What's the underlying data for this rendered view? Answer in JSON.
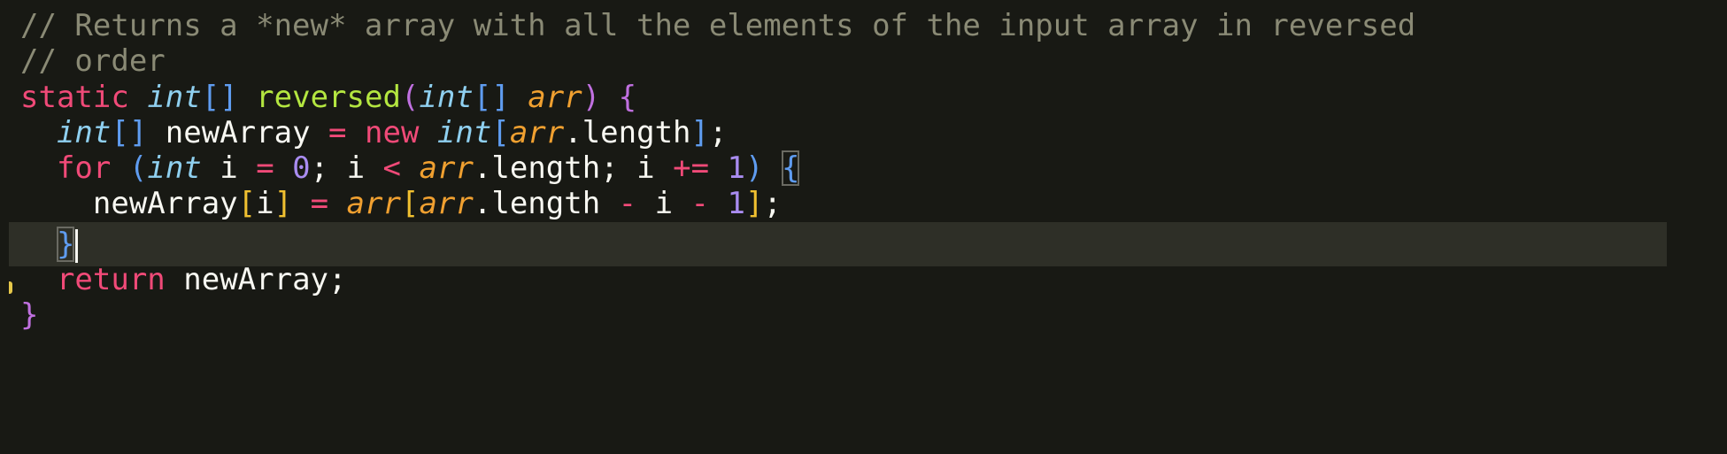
{
  "editor": {
    "language": "java",
    "lines": [
      {
        "tokens": [
          {
            "text": "// Returns a *new* array with all the elements of the input array in reversed",
            "type": "comment"
          }
        ]
      },
      {
        "tokens": [
          {
            "text": "// order",
            "type": "comment"
          }
        ]
      },
      {
        "tokens": [
          {
            "text": "static",
            "type": "keyword"
          },
          {
            "text": " ",
            "type": "punct"
          },
          {
            "text": "int",
            "type": "type"
          },
          {
            "text": "[]",
            "type": "bracket-blue"
          },
          {
            "text": " ",
            "type": "punct"
          },
          {
            "text": "reversed",
            "type": "func"
          },
          {
            "text": "(",
            "type": "paren-purple"
          },
          {
            "text": "int",
            "type": "type"
          },
          {
            "text": "[]",
            "type": "bracket-blue"
          },
          {
            "text": " ",
            "type": "punct"
          },
          {
            "text": "arr",
            "type": "param"
          },
          {
            "text": ")",
            "type": "paren-purple"
          },
          {
            "text": " ",
            "type": "punct"
          },
          {
            "text": "{",
            "type": "paren-purple"
          }
        ]
      },
      {
        "tokens": [
          {
            "text": "  ",
            "type": "punct"
          },
          {
            "text": "int",
            "type": "type"
          },
          {
            "text": "[]",
            "type": "bracket-blue"
          },
          {
            "text": " newArray ",
            "type": "ident"
          },
          {
            "text": "=",
            "type": "operator"
          },
          {
            "text": " ",
            "type": "punct"
          },
          {
            "text": "new",
            "type": "keyword"
          },
          {
            "text": " ",
            "type": "punct"
          },
          {
            "text": "int",
            "type": "type"
          },
          {
            "text": "[",
            "type": "bracket-blue"
          },
          {
            "text": "arr",
            "type": "param"
          },
          {
            "text": ".length",
            "type": "ident"
          },
          {
            "text": "]",
            "type": "bracket-blue"
          },
          {
            "text": ";",
            "type": "punct"
          }
        ]
      },
      {
        "tokens": [
          {
            "text": "  ",
            "type": "punct"
          },
          {
            "text": "for",
            "type": "keyword"
          },
          {
            "text": " ",
            "type": "punct"
          },
          {
            "text": "(",
            "type": "bracket-blue"
          },
          {
            "text": "int",
            "type": "type"
          },
          {
            "text": " i ",
            "type": "ident"
          },
          {
            "text": "=",
            "type": "operator"
          },
          {
            "text": " ",
            "type": "punct"
          },
          {
            "text": "0",
            "type": "number"
          },
          {
            "text": "; i ",
            "type": "ident"
          },
          {
            "text": "<",
            "type": "operator"
          },
          {
            "text": " ",
            "type": "punct"
          },
          {
            "text": "arr",
            "type": "param"
          },
          {
            "text": ".length; i ",
            "type": "ident"
          },
          {
            "text": "+=",
            "type": "operator"
          },
          {
            "text": " ",
            "type": "punct"
          },
          {
            "text": "1",
            "type": "number"
          },
          {
            "text": ")",
            "type": "bracket-blue"
          },
          {
            "text": " ",
            "type": "punct"
          },
          {
            "text": "{",
            "type": "brace-match"
          }
        ]
      },
      {
        "tokens": [
          {
            "text": "    newArray",
            "type": "ident"
          },
          {
            "text": "[",
            "type": "bracket-yellow"
          },
          {
            "text": "i",
            "type": "ident"
          },
          {
            "text": "]",
            "type": "bracket-yellow"
          },
          {
            "text": " ",
            "type": "punct"
          },
          {
            "text": "=",
            "type": "operator"
          },
          {
            "text": " ",
            "type": "punct"
          },
          {
            "text": "arr",
            "type": "param"
          },
          {
            "text": "[",
            "type": "bracket-yellow"
          },
          {
            "text": "arr",
            "type": "param"
          },
          {
            "text": ".length ",
            "type": "ident"
          },
          {
            "text": "-",
            "type": "operator"
          },
          {
            "text": " i ",
            "type": "ident"
          },
          {
            "text": "-",
            "type": "operator"
          },
          {
            "text": " ",
            "type": "punct"
          },
          {
            "text": "1",
            "type": "number"
          },
          {
            "text": "]",
            "type": "bracket-yellow"
          },
          {
            "text": ";",
            "type": "punct"
          }
        ]
      },
      {
        "current": true,
        "tokens": [
          {
            "text": "  ",
            "type": "punct"
          },
          {
            "text": "}",
            "type": "brace-match"
          }
        ]
      },
      {
        "tokens": [
          {
            "text": "  ",
            "type": "punct"
          },
          {
            "text": "return",
            "type": "keyword"
          },
          {
            "text": " newArray;",
            "type": "ident"
          }
        ]
      },
      {
        "tokens": [
          {
            "text": "}",
            "type": "paren-purple"
          }
        ]
      }
    ]
  },
  "colors": {
    "background": "#181914",
    "current_line": "#2e2f27",
    "comment": "#8a8a75",
    "keyword": "#f04a78",
    "type": "#8fd0f0",
    "function": "#b4e640",
    "parameter": "#f0a030",
    "number": "#a98cf0",
    "bracket_blue": "#5f9cf0",
    "bracket_purple": "#c070e0",
    "bracket_yellow": "#f0c030"
  }
}
